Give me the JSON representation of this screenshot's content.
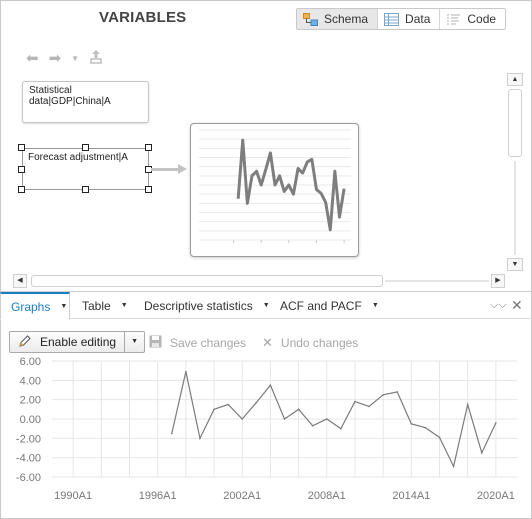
{
  "header": {
    "title": "VARIABLES"
  },
  "view_switch": [
    {
      "label": "Schema",
      "icon": "schema-icon",
      "active": true
    },
    {
      "label": "Data",
      "icon": "data-table-icon",
      "active": false
    },
    {
      "label": "Code",
      "icon": "code-icon",
      "active": false
    }
  ],
  "schema": {
    "nodes": {
      "gdp": "Statistical data|GDP|China|A",
      "forecast": "Forecast adjustment|A"
    }
  },
  "tabs": [
    {
      "label": "Graphs",
      "active": true
    },
    {
      "label": "Table",
      "active": false
    },
    {
      "label": "Descriptive statistics",
      "active": false
    },
    {
      "label": "ACF and PACF",
      "active": false
    }
  ],
  "edit_bar": {
    "enable_label": "Enable editing",
    "save_label": "Save changes",
    "undo_label": "Undo changes"
  },
  "colors": {
    "accent": "#1a7fbf",
    "series": "#7a7a7a"
  },
  "chart_data": {
    "type": "line",
    "title": "",
    "xlabel": "",
    "ylabel": "",
    "ylim": [
      -6,
      6
    ],
    "yticks": [
      "6.00",
      "4.00",
      "2.00",
      "0.00",
      "-2.00",
      "-4.00",
      "-6.00"
    ],
    "xticks": [
      "1990A1",
      "1996A1",
      "2002A1",
      "2008A1",
      "2014A1",
      "2020A1"
    ],
    "grid": true,
    "series": [
      {
        "x": [
          1997,
          1998,
          1999,
          2000,
          2001,
          2002,
          2003,
          2004,
          2005,
          2006,
          2007,
          2008,
          2009,
          2010,
          2011,
          2012,
          2013,
          2014,
          2015,
          2016,
          2017,
          2018,
          2019,
          2020
        ],
        "values": [
          -1.5,
          4.9,
          -2.0,
          1.0,
          1.5,
          0.0,
          1.7,
          3.5,
          0.0,
          1.0,
          -0.7,
          0.0,
          -1.0,
          1.8,
          1.3,
          2.5,
          2.8,
          -0.5,
          -0.9,
          -1.9,
          -4.9,
          1.5,
          -3.5,
          -0.4
        ]
      }
    ]
  }
}
